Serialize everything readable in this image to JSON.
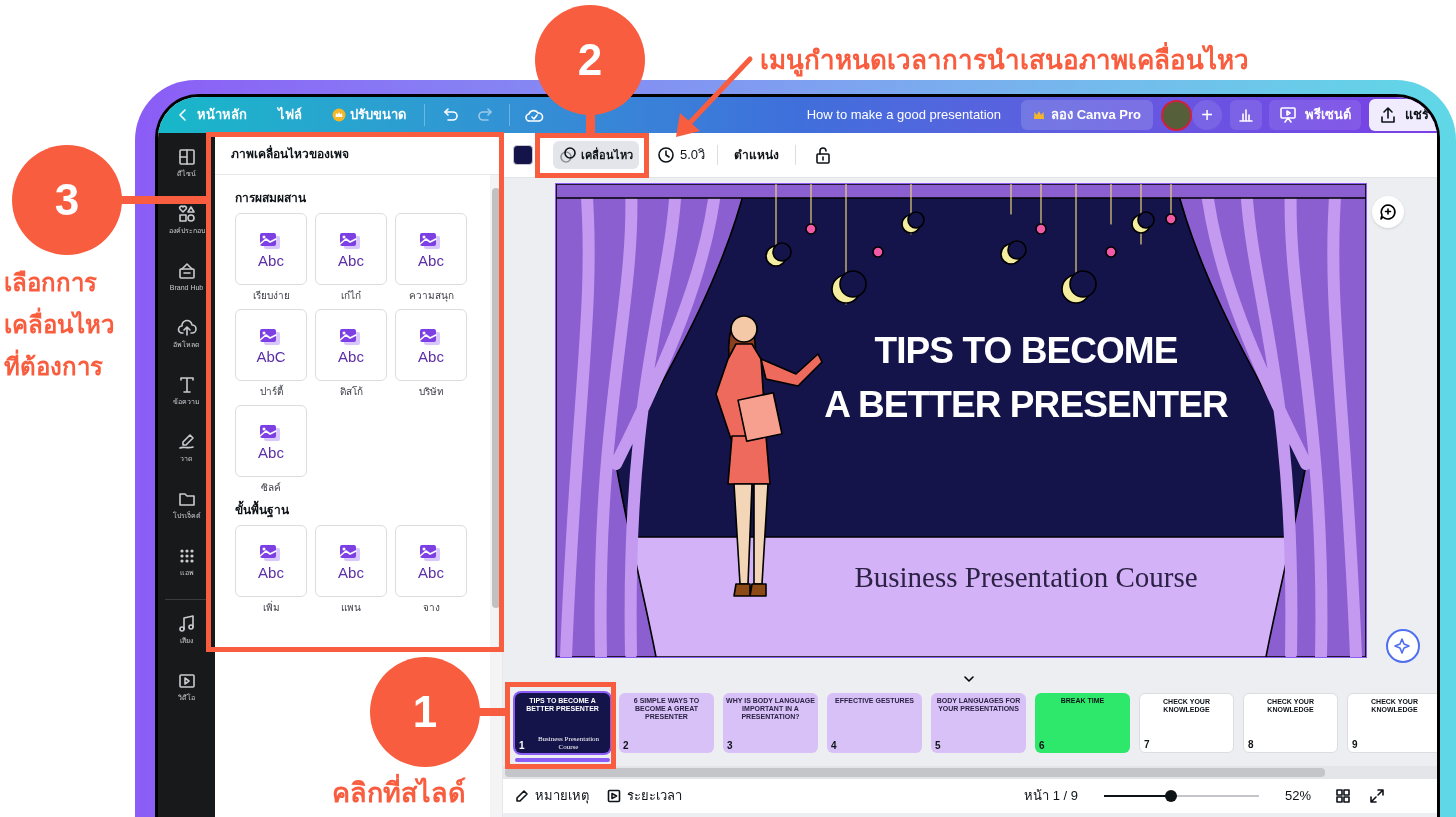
{
  "annotations": [
    {
      "number": "2",
      "caption_lines": [
        "เมนูกำหนดเวลาการนำเสนอภาพเคลื่อนไหว"
      ]
    },
    {
      "number": "3",
      "caption_lines": [
        "เลือกการ",
        "เคลื่อนไหว",
        "ที่ต้องการ"
      ]
    },
    {
      "number": "1",
      "caption_lines": [
        "คลิกที่สไลด์"
      ]
    }
  ],
  "top_bar": {
    "home": "หน้าหลัก",
    "file": "ไฟล์",
    "resize": "ปรับขนาด",
    "document_title": "How to make a good presentation",
    "pro_button": "ลอง Canva Pro",
    "add_member": "+",
    "present": "พรีเซนต์",
    "share": "แชร์"
  },
  "sidebar": {
    "items": [
      {
        "label": "ดีไซน์"
      },
      {
        "label": "องค์ประกอบ"
      },
      {
        "label": "Brand Hub"
      },
      {
        "label": "อัพโหลด"
      },
      {
        "label": "ข้อความ"
      },
      {
        "label": "วาด"
      },
      {
        "label": "โปรเจ็คต์"
      },
      {
        "label": "แอพ"
      },
      {
        "label": "เสียง"
      },
      {
        "label": "วิดีโอ"
      }
    ]
  },
  "panel": {
    "title": "ภาพเคลื่อนไหวของเพจ",
    "sections": [
      {
        "title": "การผสมผสาน",
        "items": [
          {
            "label": "เรียบง่าย",
            "preview": "Abc"
          },
          {
            "label": "เก๋ไก๋",
            "preview": "Abc"
          },
          {
            "label": "ความสนุก",
            "preview": "Abc"
          },
          {
            "label": "ปาร์ตี้",
            "preview": "AbC"
          },
          {
            "label": "ดิสโก้",
            "preview": "Abc"
          },
          {
            "label": "บริษัท",
            "preview": "Abc"
          },
          {
            "label": "ซิลค์",
            "preview": "Abc"
          }
        ]
      },
      {
        "title": "ขั้นพื้นฐาน",
        "items": [
          {
            "label": "เพิ่ม",
            "preview": "Abc"
          },
          {
            "label": "แพน",
            "preview": "Abc"
          },
          {
            "label": "จาง",
            "preview": "Abc"
          }
        ]
      }
    ]
  },
  "toolbar": {
    "animate": {
      "label": "เคลื่อนไหว",
      "selected": true
    },
    "duration": "5.0วิ",
    "position": "ตำแหน่ง"
  },
  "slide": {
    "title_lines": [
      "TIPS TO BECOME",
      "A BETTER PRESENTER"
    ],
    "subtitle": "Business Presentation Course"
  },
  "thumbnails": [
    {
      "number": "1",
      "kind": "stage",
      "title": "TIPS TO BECOME A BETTER PRESENTER",
      "subtitle": "Business Presentation Course",
      "selected": true
    },
    {
      "number": "2",
      "kind": "light",
      "title": "6 SIMPLE WAYS TO BECOME A GREAT PRESENTER",
      "selected": false
    },
    {
      "number": "3",
      "kind": "light",
      "title": "WHY IS BODY LANGUAGE IMPORTANT IN A PRESENTATION?",
      "selected": false
    },
    {
      "number": "4",
      "kind": "light",
      "title": "EFFECTIVE GESTURES",
      "selected": false
    },
    {
      "number": "5",
      "kind": "light",
      "title": "BODY LANGUAGES FOR YOUR PRESENTATIONS",
      "selected": false
    },
    {
      "number": "6",
      "kind": "break",
      "title": "BREAK TIME",
      "selected": false
    },
    {
      "number": "7",
      "kind": "white",
      "title": "CHECK YOUR KNOWLEDGE",
      "selected": false
    },
    {
      "number": "8",
      "kind": "white",
      "title": "CHECK YOUR KNOWLEDGE",
      "selected": false
    },
    {
      "number": "9",
      "kind": "white",
      "title": "CHECK YOUR KNOWLEDGE",
      "selected": false
    }
  ],
  "bottom_bar": {
    "notes": "หมายเหตุ",
    "timer": "ระยะเวลา",
    "page": "หน้า 1 / 9",
    "zoom": {
      "level": 0.43,
      "reading": "52%"
    }
  }
}
